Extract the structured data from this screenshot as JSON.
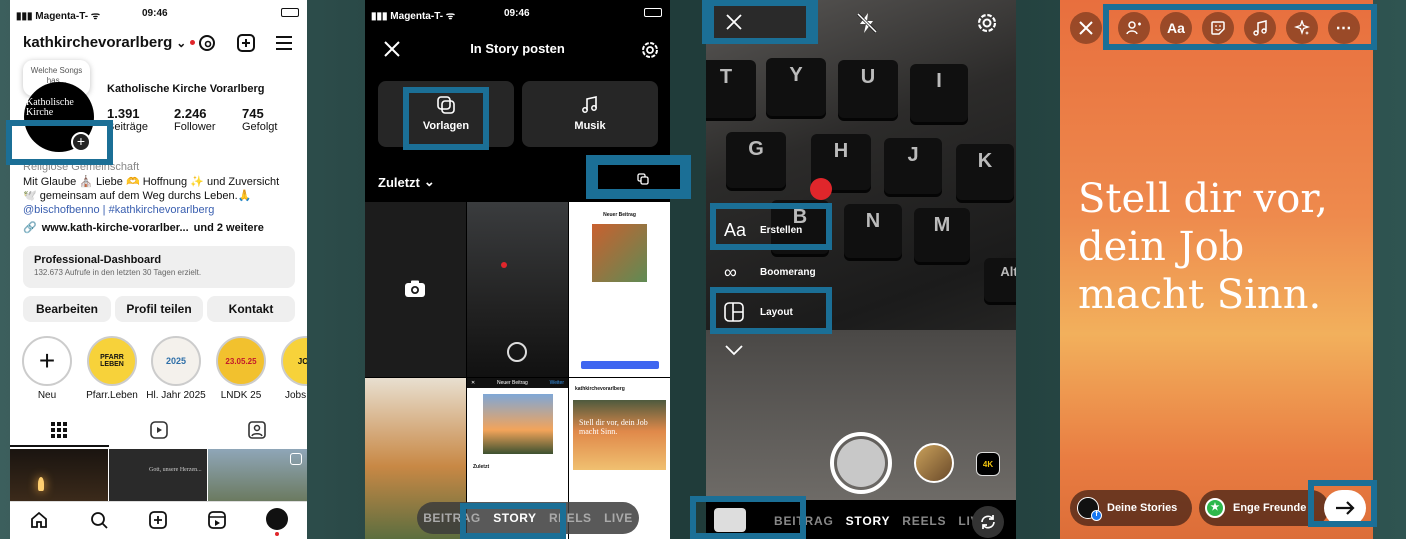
{
  "status": {
    "carrier": "Magenta-T-",
    "time": "09:46"
  },
  "p1": {
    "username": "kathkirchevorarlberg",
    "dropdown": "⌄",
    "tooltip": "Welche Songs has...",
    "avatar_text": "Katholische Kirche",
    "display_name": "Katholische Kirche Vorarlberg",
    "stats": [
      {
        "n": "1.391",
        "l": "Beiträge"
      },
      {
        "n": "2.246",
        "l": "Follower"
      },
      {
        "n": "745",
        "l": "Gefolgt"
      }
    ],
    "category": "Religiöse Gemeinschaft",
    "bio1": "Mit Glaube ⛪ Liebe 🫶 Hoffnung ✨ und Zuversicht",
    "bio2": "🕊️ gemeinsam auf dem Weg durchs Leben.🙏",
    "bio3": "@bischofbenno | #kathkirchevorarlberg",
    "link": "www.kath-kirche-vorarlber...",
    "link_more": "und 2 weitere",
    "dash_title": "Professional-Dashboard",
    "dash_sub": "132.673 Aufrufe in den letzten 30 Tagen erzielt.",
    "buttons": [
      "Bearbeiten",
      "Profil teilen",
      "Kontakt"
    ],
    "highlights": [
      {
        "label": "Neu",
        "text": "+"
      },
      {
        "label": "Pfarr.Leben",
        "text": "PFARR LEBEN"
      },
      {
        "label": "Hl. Jahr 2025",
        "text": "2025"
      },
      {
        "label": "LNDK 25",
        "text": "23.05.25"
      },
      {
        "label": "Jobs m",
        "text": "JOB"
      }
    ],
    "post2_text": "Gott, unsere Herzen..."
  },
  "p2": {
    "title": "In Story posten",
    "tiles": [
      "Vorlagen",
      "Musik"
    ],
    "recent": "Zuletzt",
    "modes": [
      "BEITRAG",
      "STORY",
      "REELS",
      "LIVE"
    ],
    "thumb_title": "Neuer Beitrag",
    "thumb_next": "Weiter",
    "thumb_zuletzt": "Zuletzt",
    "thumb_quote": "Stell dir vor, dein Job macht Sinn."
  },
  "p3": {
    "keys": [
      "T",
      "Y",
      "U",
      "I",
      "G",
      "H",
      "J",
      "K",
      "B",
      "N",
      "M",
      "Alt"
    ],
    "menu": [
      "Erstellen",
      "Boomerang",
      "Layout"
    ],
    "modes": [
      "BEITRAG",
      "STORY",
      "REELS",
      "LIVE"
    ],
    "badge": "4K"
  },
  "p4": {
    "tools": [
      "Aa"
    ],
    "quote": "Stell dir vor, dein Job macht Sinn.",
    "share1": "Deine Stories",
    "share2": "Enge Freunde"
  },
  "colors": {
    "highlight": "#1b6f96",
    "ig_blue": "#3797f0",
    "red": "#e0262b"
  }
}
